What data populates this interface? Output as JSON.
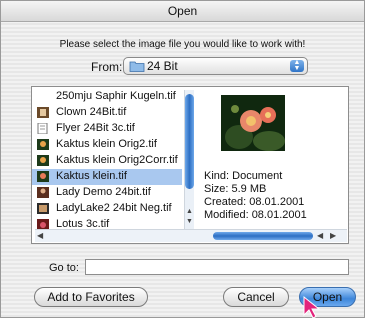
{
  "window": {
    "title": "Open"
  },
  "dialog": {
    "instruction": "Please select the image file you would like to work with!",
    "from_label": "From:",
    "from_value": "24 Bit"
  },
  "file_list": [
    {
      "name": "250mju Saphir Kugeln.tif",
      "selected": false
    },
    {
      "name": "Clown 24Bit.tif",
      "selected": false
    },
    {
      "name": "Flyer 24Bit 3c.tif",
      "selected": false
    },
    {
      "name": "Kaktus klein Orig2.tif",
      "selected": false
    },
    {
      "name": "Kaktus klein Orig2Corr.tif",
      "selected": false
    },
    {
      "name": "Kaktus klein.tif",
      "selected": true
    },
    {
      "name": "Lady Demo 24bit.tif",
      "selected": false
    },
    {
      "name": "LadyLake2 24bit Neg.tif",
      "selected": false
    },
    {
      "name": "Lotus 3c.tif",
      "selected": false
    }
  ],
  "preview": {
    "kind": "Kind: Document",
    "size": "Size: 5.9 MB",
    "created": "Created: 08.01.2001",
    "modified": "Modified: 08.01.2001"
  },
  "goto": {
    "label": "Go to:",
    "value": ""
  },
  "buttons": {
    "add_favorites": "Add to Favorites",
    "cancel": "Cancel",
    "open": "Open"
  },
  "colors": {
    "selection": "#a9c8ef",
    "accent": "#2f74c7"
  }
}
